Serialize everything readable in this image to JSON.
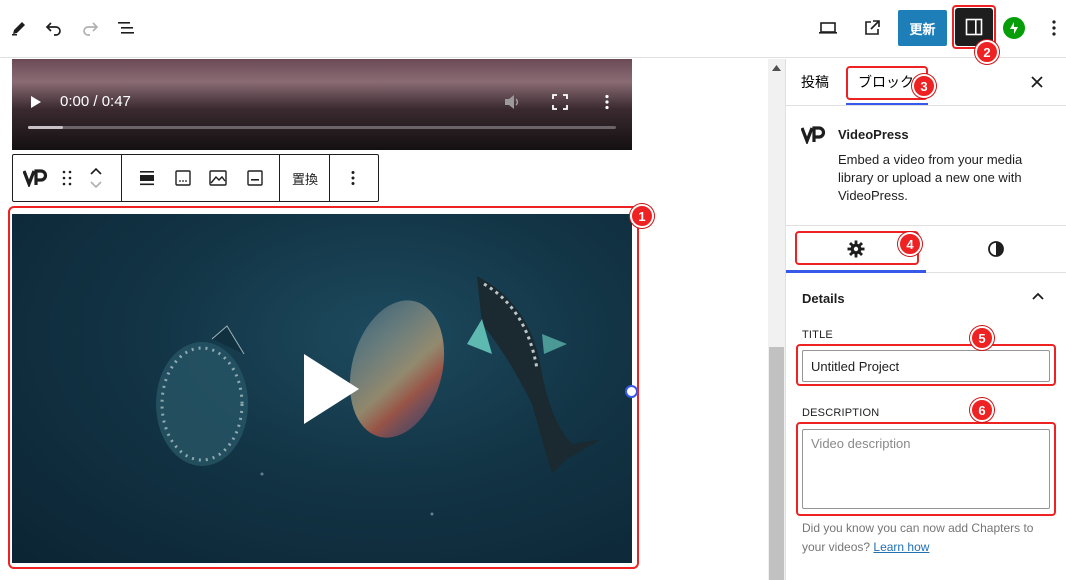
{
  "toolbar": {
    "update_label": "更新"
  },
  "video_player": {
    "time": "0:00 / 0:47",
    "progress_fraction": 0.06
  },
  "block_toolbar": {
    "replace_label": "置換"
  },
  "sidebar": {
    "tabs": [
      {
        "label": "投稿"
      },
      {
        "label": "ブロック"
      }
    ],
    "block": {
      "name": "VideoPress",
      "description": "Embed a video from your media library or upload a new one with VideoPress."
    },
    "panel": {
      "heading": "Details",
      "title_label": "TITLE",
      "title_value": "Untitled Project",
      "description_label": "DESCRIPTION",
      "description_placeholder": "Video description",
      "help_text": "Did you know you can now add Chapters to your videos?",
      "help_link": "Learn how"
    }
  },
  "callouts": [
    "1",
    "2",
    "3",
    "4",
    "5",
    "6"
  ],
  "colors": {
    "accent": "#3858e9",
    "update_button": "#1e7fb8",
    "callout": "#e22222",
    "jetpack": "#069e08"
  }
}
